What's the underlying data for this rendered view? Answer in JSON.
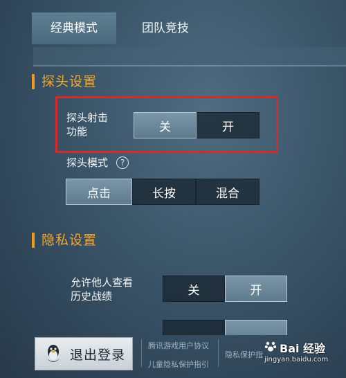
{
  "tabs": [
    {
      "label": "经典模式",
      "active": true
    },
    {
      "label": "团队竞技",
      "active": false
    }
  ],
  "peek_section": {
    "title": "探头设置",
    "peek_fire": {
      "label_line1": "探头射击",
      "label_line2": "功能",
      "options": [
        "关",
        "开"
      ],
      "selected": "关"
    },
    "peek_mode": {
      "label": "探头模式",
      "help_glyph": "?",
      "options": [
        "点击",
        "长按",
        "混合"
      ],
      "selected": "点击"
    }
  },
  "privacy_section": {
    "title": "隐私设置",
    "allow_history": {
      "label_line1": "允许他人查看",
      "label_line2": "历史战绩",
      "options": [
        "关",
        "开"
      ],
      "selected": "开"
    }
  },
  "footer": {
    "logout_label": "退出登录",
    "links": [
      "腾讯游戏用户协议",
      "儿童隐私保护指引",
      "隐私保护指"
    ]
  },
  "watermark": {
    "brand": "Bai 经验",
    "url": "jingyan.baidu.com"
  },
  "colors": {
    "accent": "#f29a1e",
    "highlight": "#d62b2b"
  }
}
